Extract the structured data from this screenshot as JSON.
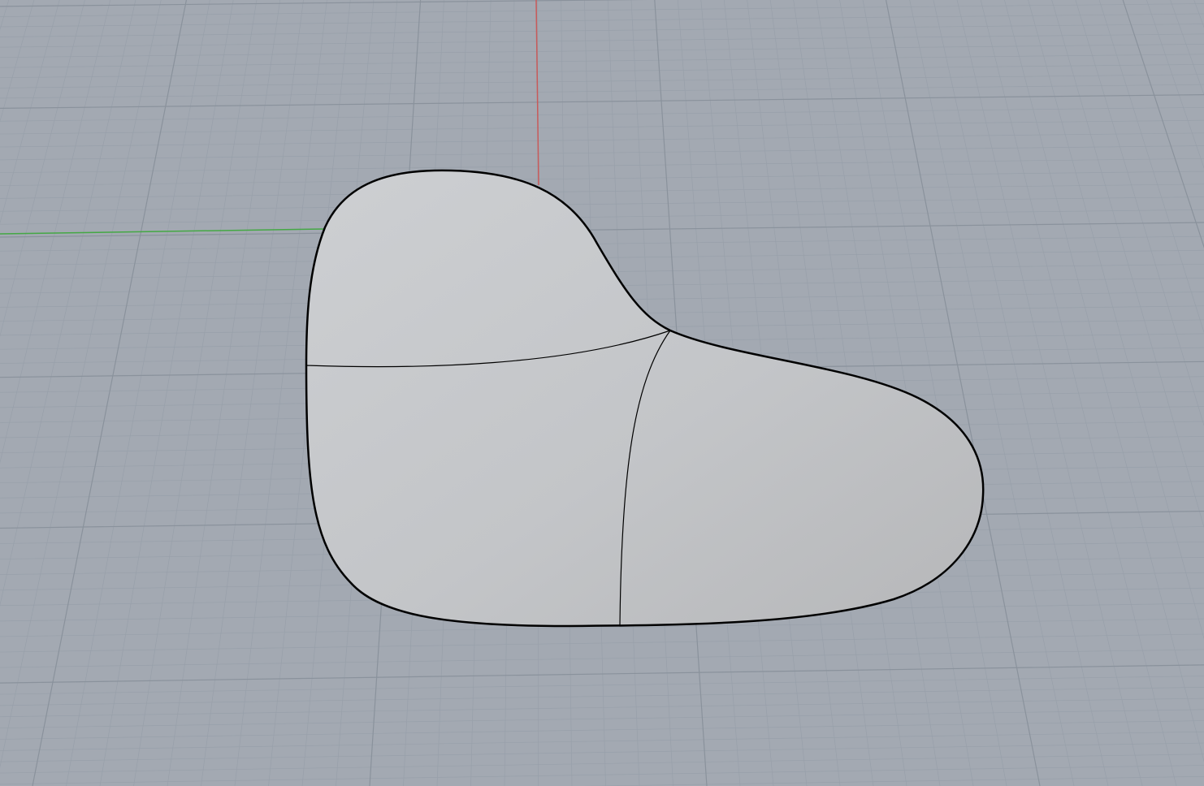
{
  "viewport": {
    "projection": "perspective",
    "background_color": "#a3a9b2",
    "minor_grid_color": "#98a0aa",
    "major_grid_color": "#8a929c",
    "x_axis_color": "#c85a5a",
    "y_axis_color": "#44a844"
  },
  "object": {
    "type": "surface",
    "fill_color": "#c4c6c9",
    "edge_color": "#000000",
    "isocurve_count": 2
  }
}
